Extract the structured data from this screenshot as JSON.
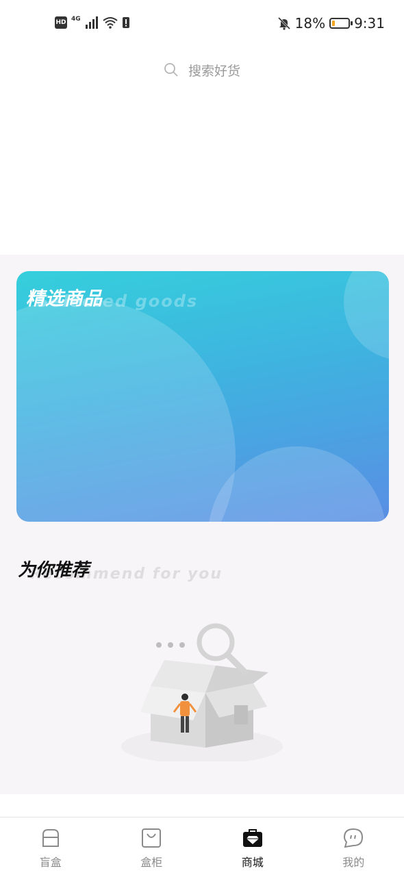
{
  "status_bar": {
    "hd": "HD",
    "network": "4G",
    "battery_percent": "18%",
    "battery_level": 0.18,
    "time": "9:31"
  },
  "search": {
    "placeholder": "搜索好货",
    "icon": "search-icon"
  },
  "featured": {
    "title": "精选商品",
    "subtitle": "Selected goods",
    "colors": {
      "start": "#35cfdc",
      "end": "#5a8ee4"
    }
  },
  "recommend": {
    "title": "为你推荐",
    "subtitle": "Recommend for you"
  },
  "tabs": [
    {
      "label": "盲盒",
      "icon": "mystery-box-icon",
      "active": false
    },
    {
      "label": "盒柜",
      "icon": "shopping-bag-icon",
      "active": false
    },
    {
      "label": "商城",
      "icon": "store-diamond-icon",
      "active": true
    },
    {
      "label": "我的",
      "icon": "chat-bubble-icon",
      "active": false
    }
  ],
  "colors": {
    "accent": "#111111",
    "inactive": "#8a8a8a",
    "background": "#f7f5f8"
  }
}
